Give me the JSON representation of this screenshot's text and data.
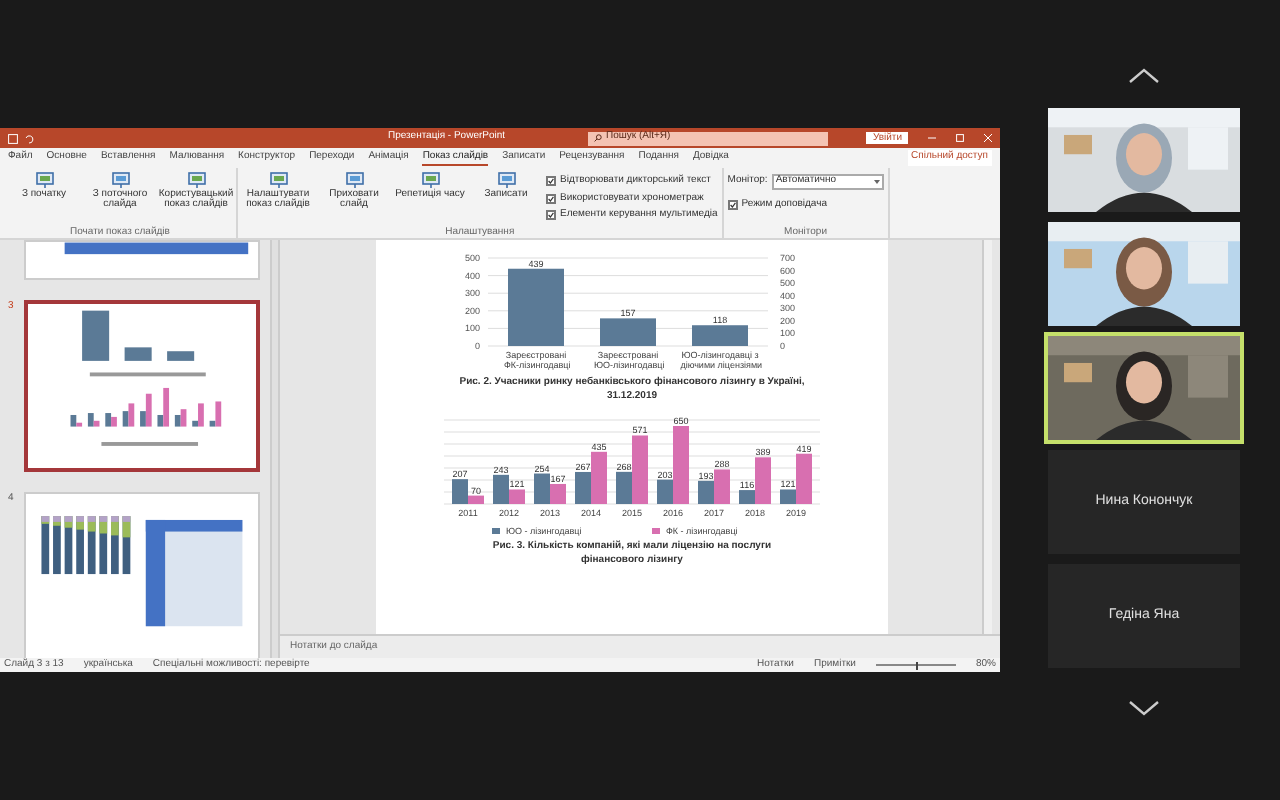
{
  "window": {
    "title": "Презентація - PowerPoint",
    "search_placeholder": "Пошук (Alt+Я)",
    "sign_in": "Увійти"
  },
  "tabs": [
    {
      "label": "Файл",
      "selected": false
    },
    {
      "label": "Основне",
      "selected": false
    },
    {
      "label": "Вставлення",
      "selected": false
    },
    {
      "label": "Малювання",
      "selected": false
    },
    {
      "label": "Конструктор",
      "selected": false
    },
    {
      "label": "Переходи",
      "selected": false
    },
    {
      "label": "Анімація",
      "selected": false
    },
    {
      "label": "Показ слайдів",
      "selected": true
    },
    {
      "label": "Записати",
      "selected": false
    },
    {
      "label": "Рецензування",
      "selected": false
    },
    {
      "label": "Подання",
      "selected": false
    },
    {
      "label": "Довідка",
      "selected": false
    }
  ],
  "share": "Спільний доступ",
  "ribbon": [
    {
      "label": "Почати показ слайдів",
      "items": [
        {
          "kind": "button",
          "label": "З початку"
        },
        {
          "kind": "button",
          "label": "З поточного слайда"
        },
        {
          "kind": "button",
          "label": "Користувацький показ слайдів"
        }
      ]
    },
    {
      "label": "Налаштування",
      "items": [
        {
          "kind": "button",
          "label": "Налаштувати показ слайдів"
        },
        {
          "kind": "button",
          "label": "Приховати слайд"
        },
        {
          "kind": "button",
          "label": "Репетиція часу"
        },
        {
          "kind": "button",
          "label": "Записати"
        },
        {
          "kind": "checks",
          "checks": [
            {
              "label": "Відтворювати дикторський текст",
              "checked": true
            },
            {
              "label": "Використовувати хронометраж",
              "checked": true
            },
            {
              "label": "Елементи керування мультимедіа",
              "checked": true
            }
          ]
        }
      ]
    },
    {
      "label": "Монітори",
      "items": [
        {
          "kind": "monitor",
          "label": "Монітор:",
          "value": "Автоматично",
          "checks": [
            {
              "label": "Режим доповідача",
              "checked": true
            }
          ]
        }
      ]
    }
  ],
  "thumbnails": [
    {
      "kind": "table",
      "selected": false
    },
    {
      "kind": "charts",
      "number": "3",
      "selected": true
    },
    {
      "kind": "mixed",
      "number": "4",
      "selected": false
    }
  ],
  "slide": {
    "charts": [
      {
        "chart_data": {
          "type": "bar",
          "categories": [
            "Зареєстровані ФК-лізингодавці",
            "Зареєстровані ЮО-лізингодавці",
            "ЮО-лізингодавці з діючими ліцензіями"
          ],
          "values": [
            439,
            157,
            118
          ],
          "ylim": [
            0,
            500
          ],
          "yticks": [
            0,
            100,
            200,
            300,
            400,
            500
          ],
          "y2lim": [
            0,
            700
          ],
          "y2ticks": [
            0,
            100,
            200,
            300,
            400,
            500,
            600,
            700
          ],
          "grid": true,
          "data_labels": true
        },
        "caption": "Рис. 2. Учасники ринку небанківського фінансового лізингу в Україні, 31.12.2019"
      },
      {
        "chart_data": {
          "type": "bar",
          "categories": [
            "2011",
            "2012",
            "2013",
            "2014",
            "2015",
            "2016",
            "2017",
            "2018",
            "2019"
          ],
          "series": [
            {
              "name": "ЮО - лізингодавці",
              "color": "#5b7a96",
              "values": [
                207,
                243,
                254,
                267,
                268,
                203,
                193,
                116,
                121
              ]
            },
            {
              "name": "ФК - лізингодавці",
              "color": "#d86fb0",
              "values": [
                70,
                121,
                167,
                435,
                571,
                650,
                288,
                389,
                419
              ]
            }
          ],
          "ylim": [
            0,
            700
          ],
          "grid": true,
          "legend": "bottom",
          "data_labels": true
        },
        "caption": "Рис. 3. Кількість компаній, які мали ліцензію на послуги фінансового лізингу"
      }
    ]
  },
  "notes_placeholder": "Нотатки до слайда",
  "status_bar": {
    "left": [
      "Слайд 3 з 13",
      "українська",
      "Спеціальні можливості: перевірте"
    ],
    "right": [
      "Нотатки",
      "Примітки"
    ],
    "zoom_slider": {
      "level": 0.5
    },
    "zoom": "80%"
  },
  "participants": [
    {
      "kind": "video",
      "speaking": false
    },
    {
      "kind": "video",
      "speaking": false
    },
    {
      "kind": "video",
      "speaking": true
    },
    {
      "kind": "name",
      "name": "Нина Конончук",
      "speaking": false
    },
    {
      "kind": "name",
      "name": "Гедіна Яна",
      "speaking": false
    }
  ]
}
